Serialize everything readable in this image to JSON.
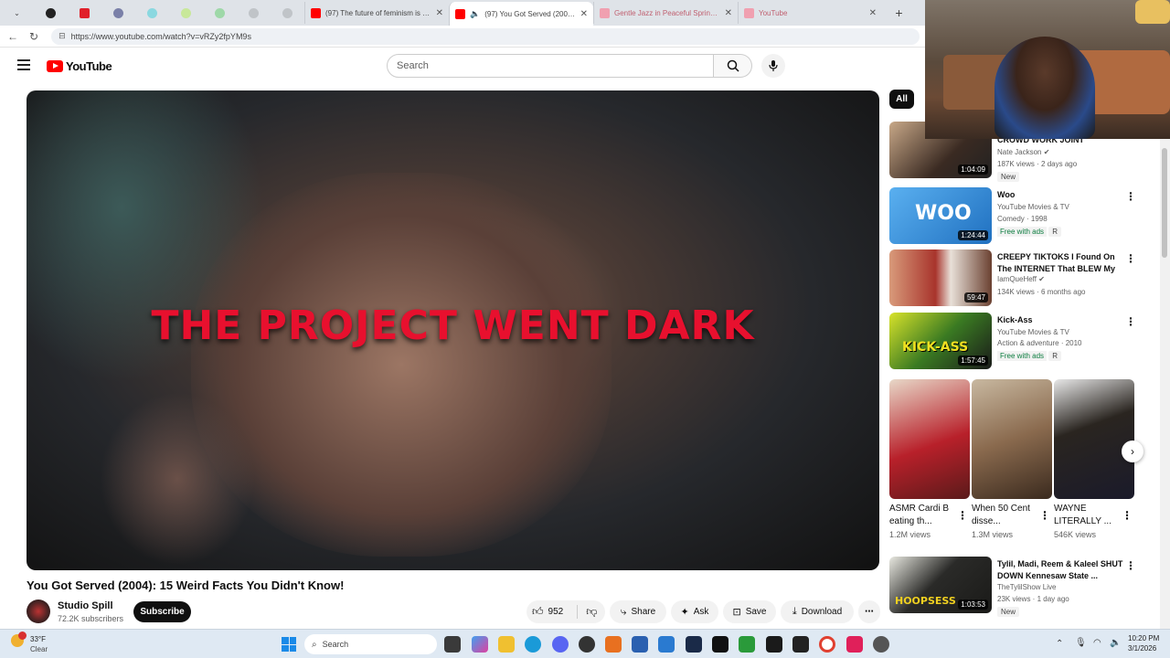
{
  "browser": {
    "tabs": [
      {
        "title": "(97) The future of feminism is goi",
        "favicon_color": "#ff0000"
      },
      {
        "title": "(97) You Got Served (2004): 15",
        "favicon_color": "#ff0000"
      },
      {
        "title": "Gentle Jazz in Peaceful Spring for",
        "favicon_color": "#ff0000"
      },
      {
        "title": "YouTube",
        "favicon_color": "#ff0000"
      }
    ],
    "new_tab": "+",
    "url": "https://www.youtube.com/watch?v=vRZy2fpYM9s"
  },
  "youtube": {
    "logo_text": "YouTube",
    "search_placeholder": "Search"
  },
  "video": {
    "overlay_text": "THE PROJECT WENT DARK",
    "title": "You Got Served (2004): 15 Weird Facts You Didn't Know!",
    "channel": "Studio Spill",
    "subscribers": "72.2K subscribers",
    "subscribe_label": "Subscribe",
    "likes": "952",
    "share_label": "Share",
    "ask_label": "Ask",
    "save_label": "Save",
    "download_label": "Download"
  },
  "sidebar": {
    "chip_all": "All",
    "related": [
      {
        "title": "CROWD WORK JOINT",
        "channel": "Nate Jackson",
        "verified": true,
        "meta": "187K views · 2 days ago",
        "badge": "New",
        "duration": "1:04:09",
        "thumb_color": "#3a2a22"
      },
      {
        "title": "Woo",
        "channel": "YouTube Movies & TV",
        "meta": "Comedy · 1998",
        "free": "Free with ads",
        "rating": "R",
        "duration": "1:24:44",
        "thumb_color": "#3a8ee0"
      },
      {
        "title": "CREEPY TIKTOKS I Found On The INTERNET That BLEW My ...",
        "channel": "IamQueHeff",
        "verified": true,
        "meta": "134K views · 6 months ago",
        "duration": "59:47",
        "thumb_color": "#a8342c"
      },
      {
        "title": "Kick-Ass",
        "channel": "YouTube Movies & TV",
        "meta": "Action & adventure · 2010",
        "free": "Free with ads",
        "rating": "R",
        "duration": "1:57:45",
        "thumb_color": "#b8c41e"
      },
      {
        "title": "Tylil, Madi, Reem & Kaleel SHUT DOWN Kennesaw State ...",
        "channel": "TheTylilShow Live",
        "meta": "23K views · 1 day ago",
        "badge": "New",
        "duration": "1:03:53",
        "thumb_color": "#2a2a28"
      }
    ],
    "shorts": [
      {
        "title": "ASMR Cardi B eating th...",
        "views": "1.2M views",
        "thumb_color": "#b8202a"
      },
      {
        "title": "When 50 Cent disse...",
        "views": "1.3M views",
        "thumb_color": "#8a6a4e"
      },
      {
        "title": "WAYNE LITERALLY ...",
        "views": "546K views",
        "thumb_color": "#2a2520"
      }
    ]
  },
  "taskbar": {
    "weather_temp": "33°F",
    "weather_desc": "Clear",
    "search_label": "Search",
    "time": "10:20 PM",
    "date": "3/1/2026"
  }
}
